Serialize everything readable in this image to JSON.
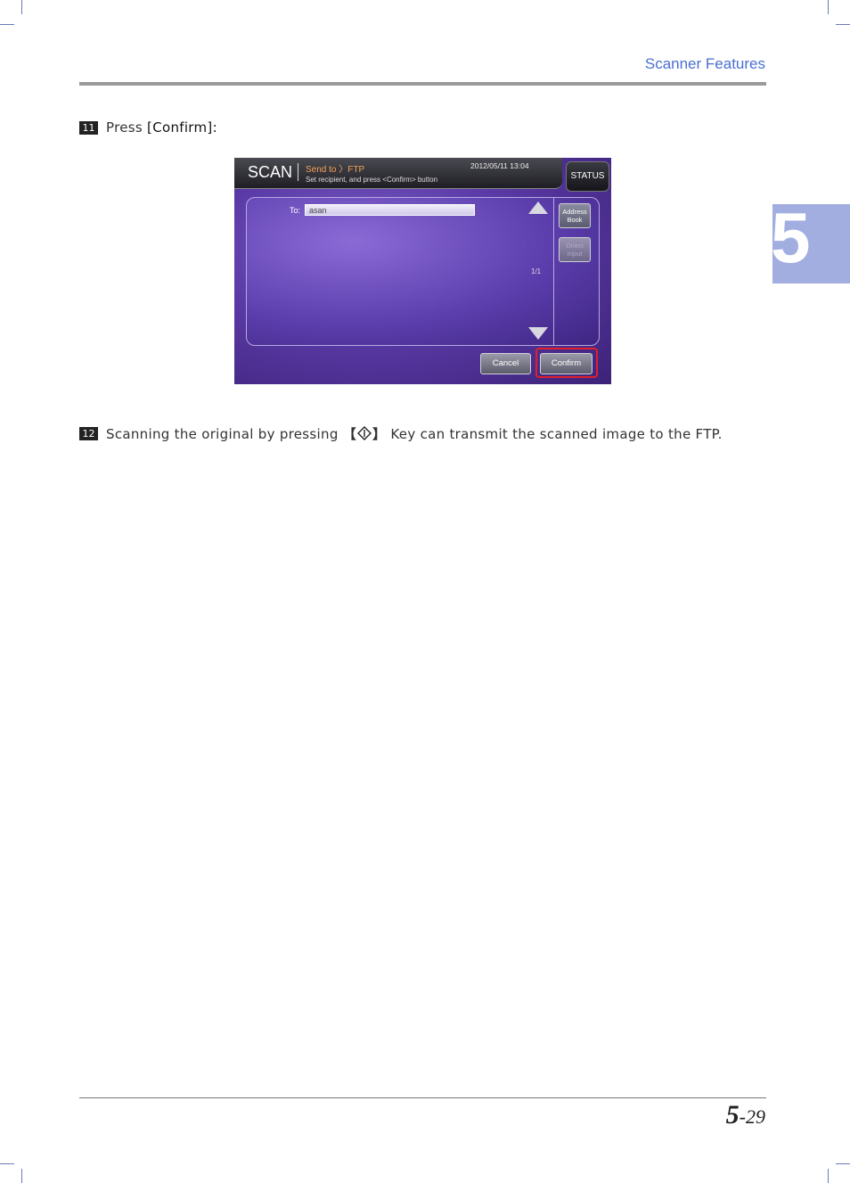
{
  "header": {
    "section_title": "Scanner Features"
  },
  "chapter_tab": {
    "number": "5"
  },
  "steps": [
    {
      "number": "11",
      "text_prefix": "Press ",
      "text_bold": "[Confirm]:"
    },
    {
      "number": "12",
      "text_before": "Scanning the original by pressing ",
      "key_open": "【",
      "key_close": "】",
      "text_after": " Key can transmit the scanned image to the FTP."
    }
  ],
  "screen": {
    "title": "SCAN",
    "breadcrumb": "Send to 〉FTP",
    "message": "Set recipient, and press <Confirm> button",
    "datetime": "2012/05/11 13:04",
    "status_button": "STATUS",
    "to_label": "To:",
    "to_value": "asan",
    "page_indicator": "1/1",
    "address_book_button": "Address Book",
    "direct_input_button": "Direct Input",
    "cancel_button": "Cancel",
    "confirm_button": "Confirm"
  },
  "footer": {
    "chapter": "5",
    "page": "-29"
  },
  "colors": {
    "accent": "#4a6fd0",
    "tab": "#a3aee0",
    "highlight": "#e0202a"
  },
  "icons": {
    "start_key": "start-key-icon",
    "arrow_up": "arrow-up-icon",
    "arrow_down": "arrow-down-icon"
  }
}
